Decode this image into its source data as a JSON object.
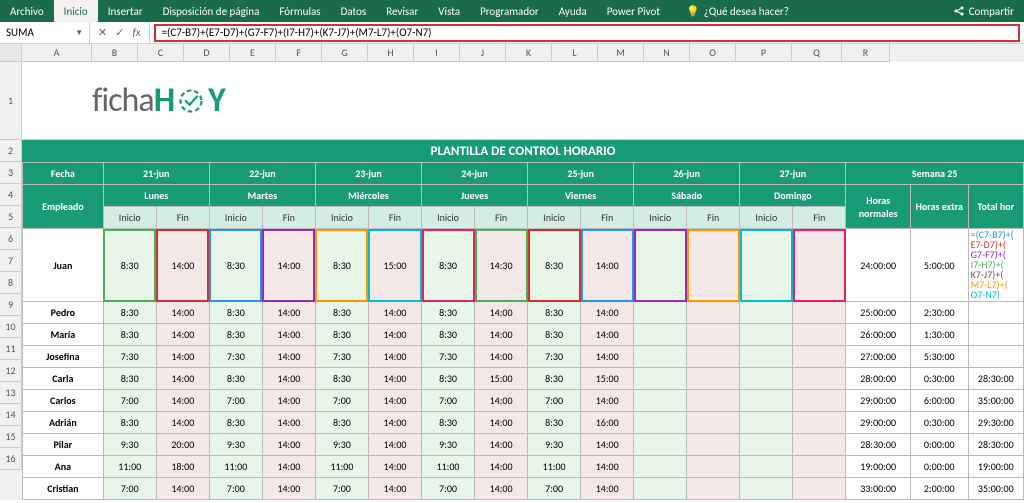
{
  "ribbon": {
    "tabs": [
      "Archivo",
      "Inicio",
      "Insertar",
      "Disposición de página",
      "Fórmulas",
      "Datos",
      "Revisar",
      "Vista",
      "Programador",
      "Ayuda",
      "Power Pivot"
    ],
    "tell_me": "¿Qué desea hacer?",
    "share": "Compartir"
  },
  "formula_bar": {
    "name_box": "SUMA",
    "formula": "=(C7-B7)+(E7-D7)+(G7-F7)+(I7-H7)+(K7-J7)+(M7-L7)+(O7-N7)"
  },
  "columns": [
    "A",
    "B",
    "C",
    "D",
    "E",
    "F",
    "G",
    "H",
    "I",
    "J",
    "K",
    "L",
    "M",
    "N",
    "O",
    "P",
    "Q",
    "R"
  ],
  "rows_labels": [
    "1",
    "2",
    "3",
    "4",
    "5",
    "6",
    "7",
    "8",
    "9",
    "10",
    "11",
    "12",
    "13",
    "14",
    "15",
    "16"
  ],
  "logo_text": {
    "p1": "ficha",
    "p2": "H",
    "p3": "Y"
  },
  "title": "PLANTILLA DE CONTROL HORARIO",
  "header": {
    "fecha": "Fecha",
    "empleado": "Empleado",
    "dates": [
      "21-jun",
      "22-jun",
      "23-jun",
      "24-jun",
      "25-jun",
      "26-jun",
      "27-jun"
    ],
    "days": [
      "Lunes",
      "Martes",
      "Miércoles",
      "Jueves",
      "Viernes",
      "Sábado",
      "Domingo"
    ],
    "inicio": "Inicio",
    "fin": "Fin",
    "semana": "Semana 25",
    "horas_normales": "Horas normales",
    "horas_extra": "Horas extra",
    "total": "Total hor"
  },
  "employees": [
    {
      "name": "Juan",
      "t": [
        "8:30",
        "14:00",
        "8:30",
        "14:00",
        "8:30",
        "15:00",
        "8:30",
        "14:30",
        "8:30",
        "14:00",
        "",
        "",
        "",
        ""
      ],
      "hn": "24:00:00",
      "he": "5:00:00",
      "tot": ""
    },
    {
      "name": "Pedro",
      "t": [
        "8:30",
        "14:00",
        "8:30",
        "14:00",
        "8:30",
        "14:00",
        "8:30",
        "14:00",
        "8:30",
        "14:00",
        "",
        "",
        "",
        ""
      ],
      "hn": "25:00:00",
      "he": "2:30:00",
      "tot": ""
    },
    {
      "name": "María",
      "t": [
        "8:30",
        "14:00",
        "8:30",
        "14:00",
        "8:30",
        "14:00",
        "8:30",
        "14:00",
        "8:30",
        "14:00",
        "",
        "",
        "",
        ""
      ],
      "hn": "26:00:00",
      "he": "1:30:00",
      "tot": ""
    },
    {
      "name": "Josefina",
      "t": [
        "7:30",
        "14:00",
        "7:30",
        "14:00",
        "7:30",
        "14:00",
        "7:30",
        "14:00",
        "7:30",
        "14:00",
        "",
        "",
        "",
        ""
      ],
      "hn": "27:00:00",
      "he": "5:30:00",
      "tot": ""
    },
    {
      "name": "Carla",
      "t": [
        "8:30",
        "14:00",
        "8:30",
        "14:00",
        "8:30",
        "14:00",
        "8:30",
        "15:00",
        "8:30",
        "15:00",
        "",
        "",
        "",
        ""
      ],
      "hn": "28:00:00",
      "he": "0:30:00",
      "tot": "28:30:00"
    },
    {
      "name": "Carlos",
      "t": [
        "7:00",
        "14:00",
        "7:00",
        "14:00",
        "7:00",
        "14:00",
        "7:00",
        "14:00",
        "7:00",
        "14:00",
        "",
        "",
        "",
        ""
      ],
      "hn": "29:00:00",
      "he": "6:00:00",
      "tot": "35:00:00"
    },
    {
      "name": "Adrián",
      "t": [
        "8:30",
        "14:00",
        "8:30",
        "14:00",
        "8:30",
        "14:00",
        "8:30",
        "14:00",
        "8:30",
        "16:00",
        "",
        "",
        "",
        ""
      ],
      "hn": "29:00:00",
      "he": "0:30:00",
      "tot": "29:30:00"
    },
    {
      "name": "Pilar",
      "t": [
        "9:30",
        "20:00",
        "9:30",
        "14:00",
        "9:30",
        "14:00",
        "9:30",
        "14:00",
        "9:30",
        "14:00",
        "",
        "",
        "",
        ""
      ],
      "hn": "28:30:00",
      "he": "0:00:00",
      "tot": "28:30:00"
    },
    {
      "name": "Ana",
      "t": [
        "11:00",
        "18:00",
        "11:00",
        "14:00",
        "11:00",
        "14:00",
        "11:00",
        "14:00",
        "11:00",
        "14:00",
        "",
        "",
        "",
        ""
      ],
      "hn": "19:00:00",
      "he": "0:00:00",
      "tot": "19:00:00"
    },
    {
      "name": "Cristian",
      "t": [
        "7:00",
        "14:00",
        "7:00",
        "14:00",
        "7:00",
        "14:00",
        "7:00",
        "14:00",
        "7:00",
        "14:00",
        "",
        "",
        "",
        ""
      ],
      "hn": "33:00:00",
      "he": "2:00:00",
      "tot": "35:00:00"
    }
  ],
  "formula_cell_parts": [
    "=(C7-B7)+(",
    "E7-D7)+(",
    "G7-F7)+(",
    "I7-H7)+(",
    "K7-J7)+(",
    "M7-L7)+(",
    "O7-N7)"
  ],
  "col_widths": {
    "emp": 70,
    "t": 46,
    "hn": 56,
    "he": 50,
    "th": 48
  }
}
